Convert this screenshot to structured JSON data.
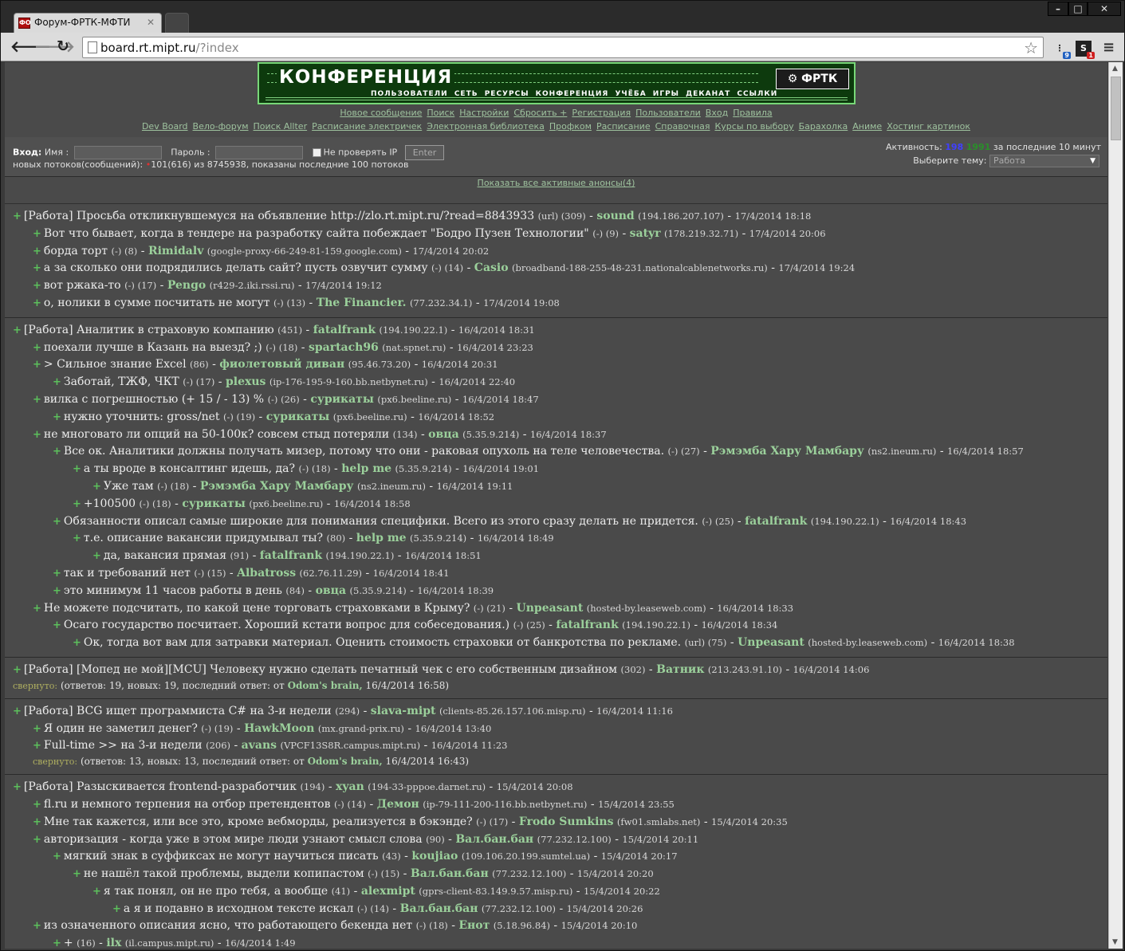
{
  "browser": {
    "tab_title": "Форум-ФРТК-МФТИ",
    "tab_favicon": "ФО",
    "url_host": "board.rt.mipt.ru",
    "url_path": "/?index",
    "ext1_badge": "9",
    "ext2_badge": "1"
  },
  "banner": {
    "title": "КОНФЕРЕНЦИЯ",
    "nav": "ПОЛЬЗОВАТЕЛИ СЕТЬ РЕСУРСЫ КОНФЕРЕНЦИЯ УЧЁБА ИГРЫ ДЕКАНАТ ССЫЛКИ",
    "logo": "ФРТК"
  },
  "links_row1": [
    "Новое сообщение",
    "Поиск",
    "Настройки",
    "Сбросить +",
    "Регистрация",
    "Пользователи",
    "Вход",
    "Правила"
  ],
  "links_row2": [
    "Dev Board",
    "Вело-форум",
    "Поиск Allter",
    "Расписание электричек",
    "Электронная библиотека",
    "Профком",
    "Расписание",
    "Справочная",
    "Курсы по выбору",
    "Барахолка",
    "Аниме",
    "Хостинг картинок"
  ],
  "login": {
    "label": "Вход:",
    "name_label": "Имя :",
    "pass_label": "Пароль :",
    "nocheck_label": "Не проверять IP",
    "enter": "Enter",
    "new_threads_prefix": "новых потоков(сообщений):",
    "new_threads_value": "101(616) из 8745938, показаны последние 100 потоков",
    "activity_label": "Активность:",
    "activity_a": "198",
    "activity_b": "1991",
    "activity_suffix": "за последние 10 минут",
    "theme_label": "Выберите тему:",
    "theme_value": "Работа"
  },
  "announce": "Показать все активные анонсы(4)",
  "threads": [
    {
      "posts": [
        {
          "lvl": 0,
          "cat": "[Работа]",
          "title": "Просьба откликнувшемуся на объявление http://zlo.rt.mipt.ru/?read=8843933",
          "n": "(url) (309)",
          "au": "sound",
          "ip": "(194.186.207.107)",
          "dt": "17/4/2014 18:18"
        },
        {
          "lvl": 1,
          "title": "Вот что бывает, когда в тендере на разработку сайта побеждает \"Бодро Пузен Технологии\"",
          "n": "(-) (9)",
          "au": "satyr",
          "ip": "(178.219.32.71)",
          "dt": "17/4/2014 20:06"
        },
        {
          "lvl": 1,
          "title": "борда торт",
          "n": "(-) (8)",
          "au": "Rimidalv",
          "ip": "(google-proxy-66-249-81-159.google.com)",
          "dt": "17/4/2014 20:02"
        },
        {
          "lvl": 1,
          "title": "а за сколько они подрядились делать сайт? пусть озвучит сумму",
          "n": "(-) (14)",
          "au": "Casio",
          "ip": "(broadband-188-255-48-231.nationalcablenetworks.ru)",
          "dt": "17/4/2014 19:24"
        },
        {
          "lvl": 1,
          "title": "вот ржака-то",
          "n": "(-) (17)",
          "au": "Pengo",
          "ip": "(r429-2.iki.rssi.ru)",
          "dt": "17/4/2014 19:12"
        },
        {
          "lvl": 1,
          "title": "о, нолики в сумме посчитать не могут",
          "n": "(-) (13)",
          "au": "The Financier.",
          "ip": "(77.232.34.1)",
          "dt": "17/4/2014 19:08"
        }
      ]
    },
    {
      "posts": [
        {
          "lvl": 0,
          "cat": "[Работа]",
          "title": "Аналитик в страховую компанию",
          "n": "(451)",
          "au": "fatalfrank",
          "ip": "(194.190.22.1)",
          "dt": "16/4/2014 18:31"
        },
        {
          "lvl": 1,
          "title": "поехали лучше в Казань на выезд? ;)",
          "n": "(-) (18)",
          "au": "spartach96",
          "ip": "(nat.spnet.ru)",
          "dt": "16/4/2014 23:23"
        },
        {
          "lvl": 1,
          "title": "> Сильное знание Excel",
          "n": "(86)",
          "au": "фиолетовый диван",
          "ip": "(95.46.73.20)",
          "dt": "16/4/2014 20:31"
        },
        {
          "lvl": 2,
          "title": "Заботай, ТЖФ, ЧКТ",
          "n": "(-) (17)",
          "au": "plexus",
          "ip": "(ip-176-195-9-160.bb.netbynet.ru)",
          "dt": "16/4/2014 22:40"
        },
        {
          "lvl": 1,
          "title": "вилка с погрешностью (+ 15 / - 13) %",
          "n": "(-) (26)",
          "au": "сурикаты",
          "ip": "(px6.beeline.ru)",
          "dt": "16/4/2014 18:47"
        },
        {
          "lvl": 2,
          "title": "нужно уточнить: gross/net",
          "n": "(-) (19)",
          "au": "сурикаты",
          "ip": "(px6.beeline.ru)",
          "dt": "16/4/2014 18:52"
        },
        {
          "lvl": 1,
          "title": "не многовато ли опций на 50-100к? совсем стыд потеряли",
          "n": "(134)",
          "au": "овца",
          "ip": "(5.35.9.214)",
          "dt": "16/4/2014 18:37"
        },
        {
          "lvl": 2,
          "title": "Все ок. Аналитики должны получать мизер, потому что они - раковая опухоль на теле человечества.",
          "n": "(-) (27)",
          "au": "Рэмэмба Хару Мамбару",
          "ip": "(ns2.ineum.ru)",
          "dt": "16/4/2014 18:57"
        },
        {
          "lvl": 3,
          "title": "а ты вроде в консалтинг идешь, да?",
          "n": "(-) (18)",
          "au": "help me",
          "ip": "(5.35.9.214)",
          "dt": "16/4/2014 19:01"
        },
        {
          "lvl": 4,
          "title": "Уже там",
          "n": "(-) (18)",
          "au": "Рэмэмба Хару Мамбару",
          "ip": "(ns2.ineum.ru)",
          "dt": "16/4/2014 19:11"
        },
        {
          "lvl": 3,
          "title": "+100500",
          "n": "(-) (18)",
          "au": "сурикаты",
          "ip": "(px6.beeline.ru)",
          "dt": "16/4/2014 18:58"
        },
        {
          "lvl": 2,
          "title": "Обязанности описал самые широкие для понимания специфики. Всего из этого сразу делать не придется.",
          "n": "(-) (25)",
          "au": "fatalfrank",
          "ip": "(194.190.22.1)",
          "dt": "16/4/2014 18:43"
        },
        {
          "lvl": 3,
          "title": "т.е. описание вакансии придумывал ты?",
          "n": "(80)",
          "au": "help me",
          "ip": "(5.35.9.214)",
          "dt": "16/4/2014 18:49"
        },
        {
          "lvl": 4,
          "title": "да, вакансия прямая",
          "n": "(91)",
          "au": "fatalfrank",
          "ip": "(194.190.22.1)",
          "dt": "16/4/2014 18:51"
        },
        {
          "lvl": 2,
          "title": "так и требований нет",
          "n": "(-) (15)",
          "au": "Albatross",
          "ip": "(62.76.11.29)",
          "dt": "16/4/2014 18:41"
        },
        {
          "lvl": 2,
          "title": "это минимум 11 часов работы в день",
          "n": "(84)",
          "au": "овца",
          "ip": "(5.35.9.214)",
          "dt": "16/4/2014 18:39"
        },
        {
          "lvl": 1,
          "title": "Не можете подсчитать, по какой цене торговать страховками в Крыму?",
          "n": "(-) (21)",
          "au": "Unpeasant",
          "ip": "(hosted-by.leaseweb.com)",
          "dt": "16/4/2014 18:33"
        },
        {
          "lvl": 2,
          "title": "Осаго государство посчитает. Хороший кстати вопрос для собеседования.)",
          "n": "(-) (25)",
          "au": "fatalfrank",
          "ip": "(194.190.22.1)",
          "dt": "16/4/2014 18:34"
        },
        {
          "lvl": 3,
          "title": "Ок, тогда вот вам для затравки материал. Оценить стоимость страховки от банкротства по рекламе.",
          "n": "(url) (75)",
          "au": "Unpeasant",
          "ip": "(hosted-by.leaseweb.com)",
          "dt": "16/4/2014 18:38"
        }
      ]
    },
    {
      "posts": [
        {
          "lvl": 0,
          "cat": "[Работа]",
          "title": "[Мопед не мой][MCU] Человеку нужно сделать печатный чек с его собственным дизайном",
          "n": "(302)",
          "au": "Ватник",
          "ip": "(213.243.91.10)",
          "dt": "16/4/2014 14:06"
        }
      ],
      "fold": {
        "lvl": 0,
        "label": "свернуто:",
        "text": "(ответов: 19, новых: 19, последний ответ: от",
        "au": "Odom's brain,",
        "dt": "16/4/2014 16:58)"
      }
    },
    {
      "posts": [
        {
          "lvl": 0,
          "cat": "[Работа]",
          "title": "BCG ищет программиста C# на 3-и недели",
          "n": "(294)",
          "au": "slava-mipt",
          "ip": "(clients-85.26.157.106.misp.ru)",
          "dt": "16/4/2014 11:16"
        },
        {
          "lvl": 1,
          "title": "Я один не заметил денег?",
          "n": "(-) (19)",
          "au": "HawkMoon",
          "ip": "(mx.grand-prix.ru)",
          "dt": "16/4/2014 13:40"
        },
        {
          "lvl": 1,
          "title": "Full-time >> на 3-и недели",
          "n": "(206)",
          "au": "avans",
          "ip": "(VPCF13S8R.campus.mipt.ru)",
          "dt": "16/4/2014 11:23"
        }
      ],
      "fold": {
        "lvl": 1,
        "label": "свернуто:",
        "text": "(ответов: 13, новых: 13, последний ответ: от",
        "au": "Odom's brain,",
        "dt": "16/4/2014 16:43)"
      }
    },
    {
      "posts": [
        {
          "lvl": 0,
          "cat": "[Работа]",
          "title": "Разыскивается frontend-разработчик",
          "n": "(194)",
          "au": "xyan",
          "ip": "(194-33-pppoe.darnet.ru)",
          "dt": "15/4/2014 20:08"
        },
        {
          "lvl": 1,
          "title": "fl.ru и немного терпения на отбор претендентов",
          "n": "(-) (14)",
          "au": "Демон",
          "ip": "(ip-79-111-200-116.bb.netbynet.ru)",
          "dt": "15/4/2014 23:55"
        },
        {
          "lvl": 1,
          "title": "Мне так кажется, или все это, кроме вебморды, реализуется в бэкэнде?",
          "n": "(-) (17)",
          "au": "Frodo Sumkins",
          "ip": "(fw01.smlabs.net)",
          "dt": "15/4/2014 20:35"
        },
        {
          "lvl": 1,
          "title": "авторизация - когда уже в этом мире люди узнают смысл слова",
          "n": "(90)",
          "au": "Вал.бан.бан",
          "ip": "(77.232.12.100)",
          "dt": "15/4/2014 20:11"
        },
        {
          "lvl": 2,
          "title": "мягкий знак в суффиксах не могут научиться писать",
          "n": "(43)",
          "au": "koujiao",
          "ip": "(109.106.20.199.sumtel.ua)",
          "dt": "15/4/2014 20:17"
        },
        {
          "lvl": 3,
          "title": "не нашёл такой проблемы, выдели копипастом",
          "n": "(-) (15)",
          "au": "Вал.бан.бан",
          "ip": "(77.232.12.100)",
          "dt": "15/4/2014 20:20"
        },
        {
          "lvl": 4,
          "title": "я так понял, он не про тебя, а вообще",
          "n": "(41)",
          "au": "alexmipt",
          "ip": "(gprs-client-83.149.9.57.misp.ru)",
          "dt": "15/4/2014 20:22"
        },
        {
          "lvl": 5,
          "title": "а я и подавно в исходном тексте искал",
          "n": "(-) (14)",
          "au": "Вал.бан.бан",
          "ip": "(77.232.12.100)",
          "dt": "15/4/2014 20:26"
        },
        {
          "lvl": 1,
          "title": "из означенного описания ясно, что работающего бекенда нет",
          "n": "(-) (18)",
          "au": "Енот",
          "ip": "(5.18.96.84)",
          "dt": "15/4/2014 20:10"
        },
        {
          "lvl": 2,
          "title": "+",
          "n": "(16)",
          "au": "ilx",
          "ip": "(il.campus.mipt.ru)",
          "dt": "16/4/2014 1:49"
        }
      ]
    }
  ]
}
